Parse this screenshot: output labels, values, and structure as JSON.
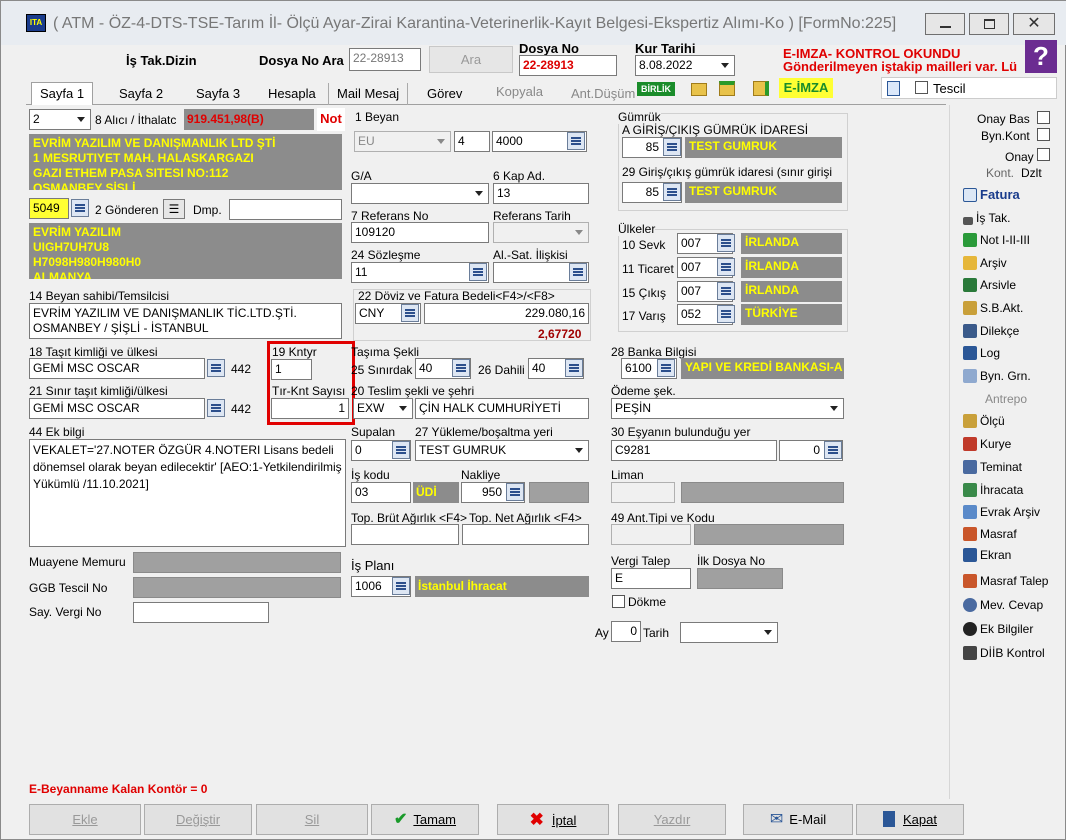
{
  "title": "( ATM - ÖZ-4-DTS-TSE-Tarım İl- Ölçü Ayar-Zirai Karantina-Veterinerlik-Kayıt Belgesi-Ekspertiz Alımı-Ko ) [FormNo:225]",
  "header": {
    "is_tak_dizin": "İş Tak.Dizin",
    "dosya_no_ara_label": "Dosya No Ara",
    "dosya_no_ara_value": "22-28913",
    "ara_button": "Ara",
    "dosya_no_label": "Dosya No",
    "dosya_no_value": "22-28913",
    "kur_tarihi_label": "Kur Tarihi",
    "kur_tarihi_value": "8.08.2022",
    "eimza_msg": "E-IMZA- KONTROL OKUNDU",
    "mail_msg": "Gönderilmeyen iştakip mailleri var. Lü"
  },
  "tabs": [
    "Sayfa 1",
    "Sayfa 2",
    "Sayfa 3",
    "Hesapla",
    "Mail Mesaj",
    "Görev",
    "Kopyala",
    "Ant.Düşüm"
  ],
  "toolbar": {
    "birlik": "BİRLİK",
    "eimza": "E-İMZA",
    "tescil": "Tescil"
  },
  "form": {
    "alici_no": "2",
    "alici_label": "8 Alıcı / İthalatc",
    "alici_amount": "919.451,98(B)",
    "not_label": "Not",
    "alici_text": [
      "EVRİM YAZILIM VE DANIŞMANLIK LTD ŞTİ",
      "1 MESRUTIYET MAH. HALASKARGAZI",
      "GAZI ETHEM PASA SITESI NO:112",
      "OSMANBEY SİŞLİ"
    ],
    "gonderen_code": "5049",
    "gonderen_label": "2 Gönderen",
    "dmp_label": "Dmp.",
    "gonderen_text": [
      "EVRİM YAZILIM",
      "UIGH7UH7U8",
      "H7098H980H980H0",
      "ALMANYA"
    ],
    "beyan_sahibi_label": "14 Beyan sahibi/Temsilcisi",
    "beyan_sahibi_text": [
      "EVRİM YAZILIM VE DANIŞMANLIK TİC.LTD.ŞTİ.",
      "OSMANBEY / ŞİŞLİ - İSTANBUL"
    ],
    "tasit_label": "18 Taşıt kimliği ve ülkesi",
    "tasit_value": "GEMİ MSC OSCAR",
    "tasit_code": "442",
    "sinir_tasit_label": "21 Sınır taşıt kimliği/ülkesi",
    "sinir_tasit_value": "GEMİ MSC OSCAR",
    "sinir_tasit_code": "442",
    "kntyr_label": "19 Kntyr",
    "kntyr_value": "1",
    "tir_knt_label": "Tır-Knt Sayısı",
    "tir_knt_value": "1",
    "ek_bilgi_label": "44 Ek bilgi",
    "ek_bilgi_text": "VEKALET='27.NOTER ÖZGÜR 4.NOTERI Lisans bedeli dönemsel olarak beyan edilecektir' [AEO:1-Yetkilendirilmiş Yükümlü /11.10.2021]",
    "muayene_label": "Muayene Memuru",
    "ggb_label": "GGB Tescil No",
    "say_vergi_label": "Say. Vergi No",
    "beyan_label": "1 Beyan",
    "beyan_value": "EU",
    "beyan_num": "4",
    "beyan_code": "4000",
    "ga_label": "G/A",
    "kap_ad_label": "6 Kap Ad.",
    "kap_ad_value": "13",
    "referans_no_label": "7 Referans No",
    "referans_no_value": "109120",
    "referans_tarih_label": "Referans Tarih",
    "sozlesme_label": "24 Sözleşme",
    "sozlesme_value": "11",
    "al_sat_label": "Al.-Sat. İlişkisi",
    "doviz_label": "22 Döviz ve Fatura Bedeli<F4>/<F8>",
    "doviz_value": "CNY",
    "doviz_amount": "229.080,16",
    "doviz_rate": "2,67720",
    "tasima_label": "Taşıma Şekli",
    "sinirdaki_label": "25 Sınırdak",
    "sinirdaki_value": "40",
    "dahili_label": "26 Dahili",
    "dahili_value": "40",
    "teslim_label": "20 Teslim şekli ve şehri",
    "teslim_value": "EXW",
    "teslim_city": "ÇİN HALK CUMHURİYETİ",
    "supalan_label": "Supalan",
    "supalan_value": "0",
    "yukleme_label": "27 Yükleme/boşaltma yeri",
    "yukleme_value": "TEST GUMRUK",
    "is_kodu_label": "İş kodu",
    "is_kodu_value": "03",
    "udi": "ÜDİ",
    "nakliye_label": "Nakliye",
    "nakliye_value": "950",
    "brut_label": "Top. Brüt Ağırlık <F4>",
    "net_label": "Top. Net Ağırlık <F4>",
    "is_plani_label": "İş Planı",
    "is_plani_value": "1006",
    "is_plani_text": "İstanbul İhracat",
    "gumruk_label": "Gümrük",
    "giris_cikis_label": "A GİRİŞ/ÇIKIŞ GÜMRÜK İDARESİ",
    "giris_cikis_value": "85",
    "giris_cikis_text": "TEST GUMRUK",
    "giris29_label": "29 Giriş/çıkış gümrük idaresi (sınır girişi",
    "giris29_value": "85",
    "giris29_text": "TEST GUMRUK",
    "ulkeler_label": "Ülkeler",
    "sevk_label": "10 Sevk",
    "sevk_value": "007",
    "sevk_text": "İRLANDA",
    "ticaret_label": "11 Ticaret",
    "ticaret_value": "007",
    "ticaret_text": "İRLANDA",
    "cikis_label": "15 Çıkış",
    "cikis_value": "007",
    "cikis_text": "İRLANDA",
    "varis_label": "17 Varış",
    "varis_value": "052",
    "varis_text": "TÜRKİYE",
    "banka_label": "28 Banka Bilgisi",
    "banka_value": "6100",
    "banka_text": "YAPI VE KREDİ BANKASI-A",
    "odeme_label": "Ödeme şek.",
    "odeme_value": "PEŞİN",
    "esya_label": "30 Eşyanın bulunduğu yer",
    "esya_value": "C9281",
    "esya_num": "0",
    "liman_label": "Liman",
    "ant_tipi_label": "49 Ant.Tipi ve Kodu",
    "vergi_talep_label": "Vergi Talep",
    "vergi_talep_value": "E",
    "ilk_dosya_label": "İlk Dosya No",
    "dokme_label": "Dökme",
    "ay_label": "Ay",
    "ay_value": "0",
    "tarih_label": "Tarih",
    "kontor": "E-Beyanname Kalan Kontör = 0"
  },
  "side": {
    "onay_bas": "Onay Bas",
    "byn_kont": "Byn.Kont",
    "onay": "Onay",
    "kont": "Kont.",
    "dzlt": "Dzlt",
    "items": [
      "Fatura",
      "İş Tak.",
      "Not I-II-III",
      "Arşiv",
      "Arsivle",
      "S.B.Akt.",
      "Dilekçe",
      "Log",
      "Byn. Grn.",
      "Antrepo",
      "Ölçü",
      "Kurye",
      "Teminat",
      "İhracata",
      "Evrak Arşiv",
      "Masraf",
      "Ekran",
      "Masraf Talep",
      "Mev. Cevap",
      "Ek Bilgiler",
      "DİİB Kontrol"
    ]
  },
  "buttons": {
    "ekle": "Ekle",
    "degistir": "Değiştir",
    "sil": "Sil",
    "tamam": "Tamam",
    "iptal": "İptal",
    "yazdir": "Yazdır",
    "email": "E-Mail",
    "kapat": "Kapat"
  }
}
